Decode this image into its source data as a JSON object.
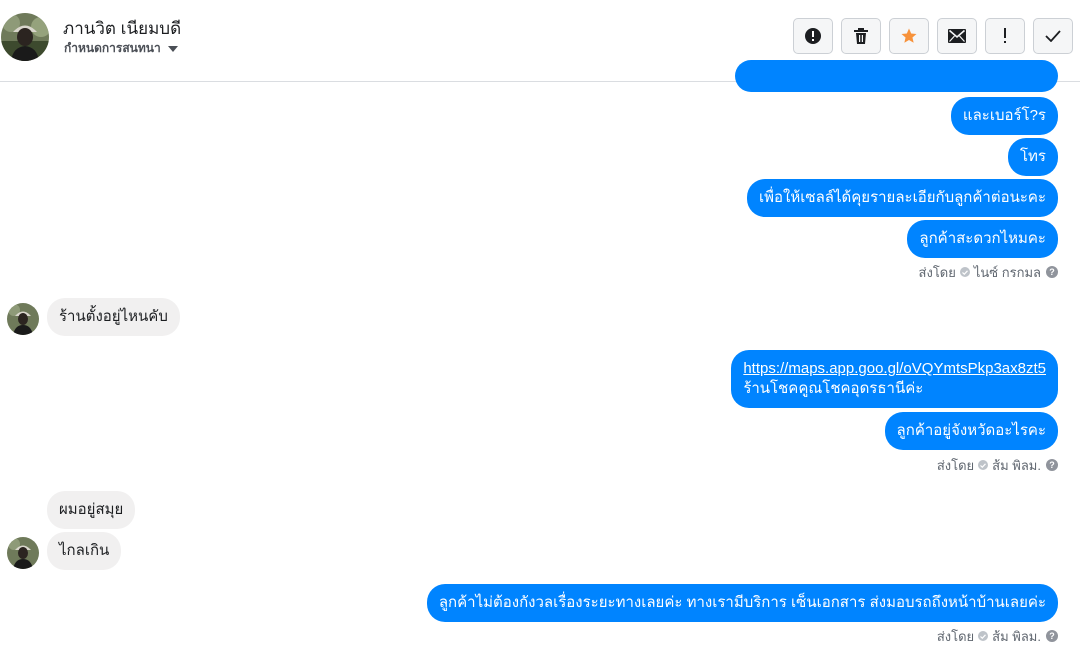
{
  "header": {
    "contact_name": "ภานวิต เนียมบดี",
    "assign_label": "กำหนดการสนทนา",
    "actions": [
      {
        "icon": "alert-circle-icon",
        "name": "report-spam-button"
      },
      {
        "icon": "trash-icon",
        "name": "delete-button"
      },
      {
        "icon": "star-icon",
        "name": "star-button"
      },
      {
        "icon": "envelope-icon",
        "name": "mark-unread-button"
      },
      {
        "icon": "exclamation-icon",
        "name": "follow-up-button"
      },
      {
        "icon": "checkmark-icon",
        "name": "mark-done-button"
      }
    ]
  },
  "messages": {
    "m2": "และเบอร์โ?ร",
    "m3": "โทร",
    "m4": "เพื่อให้เซลล์ได้คุยรายละเอียกับลูกค้าต่อนะคะ",
    "m5": "ลูกค้าสะดวกไหมคะ",
    "sent1": {
      "prefix": "ส่งโดย",
      "agent": "ไนซ์ กรกมล"
    },
    "in1": "ร้านตั้งอยู่ไหนคับ",
    "m6_link": "https://maps.app.goo.gl/oVQYmtsPkp3ax8zt5",
    "m6_text": "ร้านโชคคูณโชคอุดรธานีค่ะ",
    "m7": "ลูกค้าอยู่จังหวัดอะไรคะ",
    "sent2": {
      "prefix": "ส่งโดย",
      "agent": "ส้ม พิลม."
    },
    "in2": "ผมอยู่สมุย",
    "in3": "ไกลเกิน",
    "m8": "ลูกค้าไม่ต้องกังวลเรื่องระยะทางเลยค่ะ ทางเรามีบริการ เซ็นเอกสาร ส่งมอบรถถึงหน้าบ้านเลยค่ะ",
    "sent3": {
      "prefix": "ส่งโดย",
      "agent": "ส้ม พิลม."
    }
  },
  "colors": {
    "outgoing_bubble": "#0084ff",
    "incoming_bubble": "#f1f0f0",
    "star": "#f7923b"
  }
}
